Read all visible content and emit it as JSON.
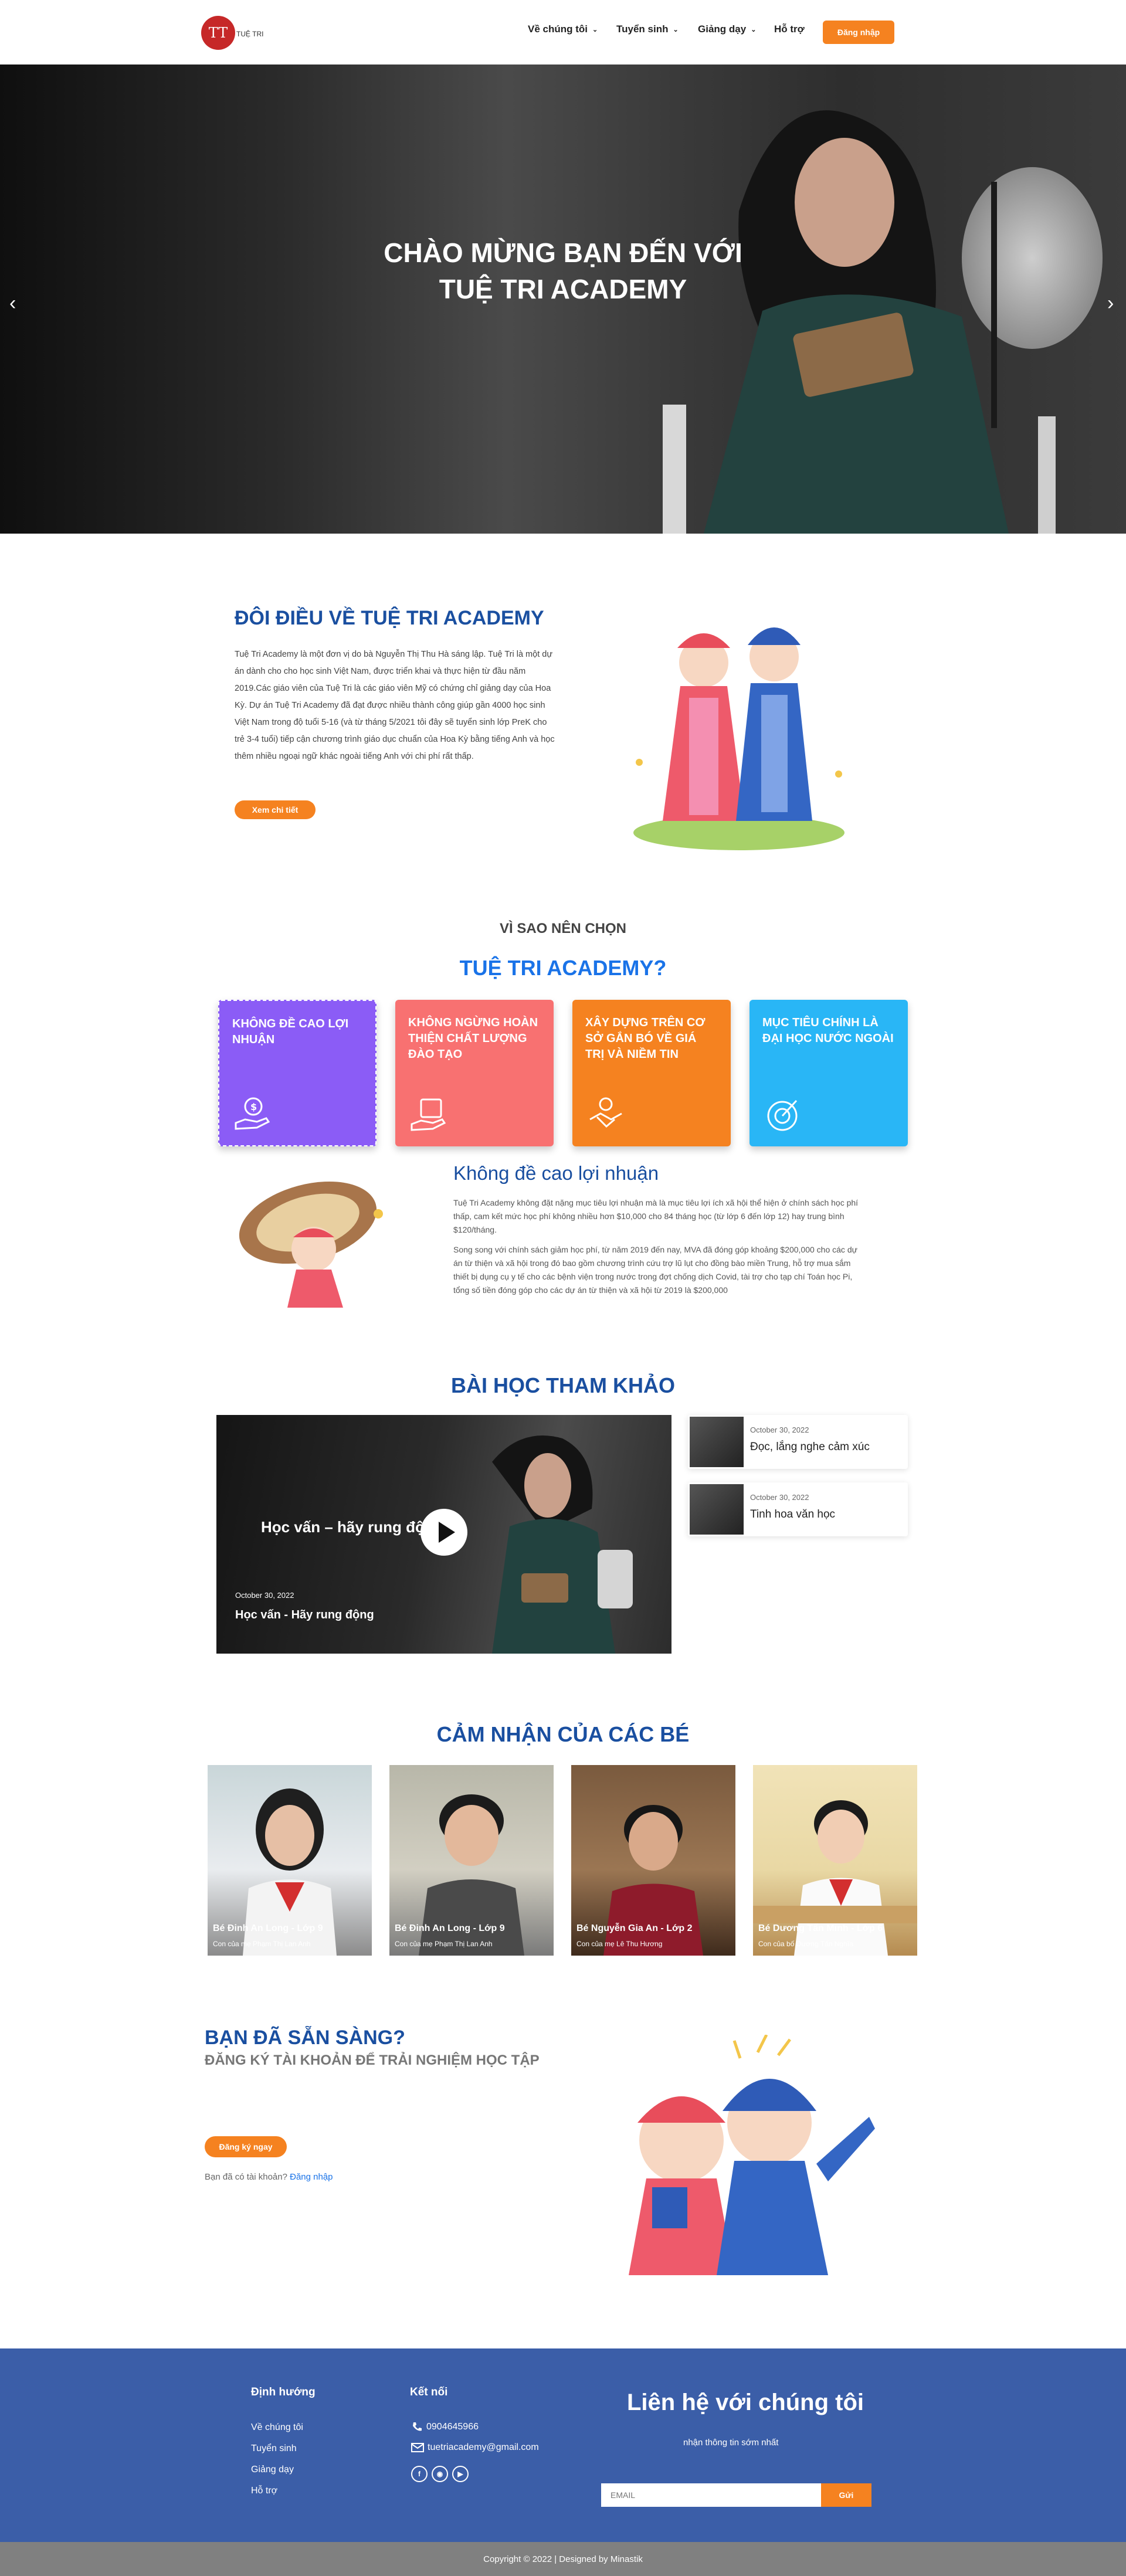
{
  "header": {
    "logo_initials": "TT",
    "logo_text": "TUỆ TRI",
    "nav": [
      {
        "label": "Về chúng tôi",
        "has_dropdown": true
      },
      {
        "label": "Tuyển sinh",
        "has_dropdown": true
      },
      {
        "label": "Giảng dạy",
        "has_dropdown": true
      },
      {
        "label": "Hỗ trợ",
        "has_dropdown": false
      }
    ],
    "login_label": "Đăng nhập",
    "accent_color": "#f58220",
    "brand_color": "#c62828"
  },
  "hero": {
    "title": "CHÀO MỪNG BẠN ĐẾN VỚI\nTUỆ TRI ACADEMY",
    "prev_icon": "chevron-left-icon",
    "next_icon": "chevron-right-icon"
  },
  "about": {
    "title": "ĐÔI ĐIỀU VỀ TUỆ TRI ACADEMY",
    "body": "Tuệ Tri Academy là một đơn vị do bà Nguyễn Thị Thu Hà sáng lập. Tuệ Tri là một dự án dành cho cho học sinh Việt Nam, được triển khai và thực hiện từ đầu năm 2019.Các giáo viên của Tuệ Tri là các giáo viên Mỹ có chứng chỉ giảng dạy của Hoa Kỳ. Dự án Tuệ Tri Academy đã đạt được nhiều thành công giúp gần 4000 học sinh Việt Nam trong độ tuổi 5-16 (và từ tháng 5/2021 tôi đây sẽ tuyển sinh lớp PreK cho trẻ 3-4 tuổi) tiếp cận chương trình giáo dục chuẩn của Hoa Kỳ bằng tiếng Anh và học thêm nhiều ngoại ngữ khác ngoài tiếng Anh với chi phí rất thấp.",
    "button": "Xem chi tiết"
  },
  "why": {
    "subtitle": "VÌ SAO NÊN CHỌN",
    "title": "TUỆ TRI ACADEMY?",
    "cards": [
      {
        "label": "KHÔNG ĐỀ CAO LỢI NHUẬN",
        "color": "#8b5cf6",
        "icon": "money-hand-icon"
      },
      {
        "label": "KHÔNG NGỪNG HOÀN THIỆN CHẤT LƯỢNG ĐÀO TẠO",
        "color": "#f87171",
        "icon": "quality-hand-icon"
      },
      {
        "label": "XÂY DỰNG TRÊN CƠ SỞ GẮN BÓ VỀ GIÁ TRỊ VÀ NIỀM TIN",
        "color": "#f58220",
        "icon": "handshake-icon"
      },
      {
        "label": "MỤC TIÊU CHÍNH LÀ ĐẠI HỌC NƯỚC NGOÀI",
        "color": "#29b6f6",
        "icon": "target-icon"
      }
    ],
    "detail_title": "Không đề cao lợi nhuận",
    "detail_p1": "Tuệ Tri Academy không đặt nặng mục tiêu lợi nhuận mà là mục tiêu lợi ích xã hội thể hiện ở chính sách học phí thấp, cam kết mức học phí không nhiều hơn $10,000 cho 84 tháng học (từ lớp 6 đến lớp 12) hay trung bình $120/tháng.",
    "detail_p2": "Song song với chính sách giảm học phí, từ năm 2019 đến nay, MVA đã đóng góp khoảng $200,000 cho các dự án từ thiện và xã hội trong đó bao gồm chương trình cứu trợ lũ lụt cho đồng bào miền Trung, hỗ trợ mua sắm thiết bị dụng cụ y tế cho các bệnh viện trong nước trong đợt chống dịch Covid, tài trợ cho tạp chí Toán học Pi, tổng số tiền đóng góp cho các dự án từ thiện và xã hội từ 2019 là $200,000"
  },
  "lessons": {
    "title": "BÀI HỌC THAM KHẢO",
    "featured": {
      "overlay": "Học vấn – hãy rung động",
      "date": "October 30, 2022",
      "title": "Học vấn - Hãy rung động"
    },
    "side": [
      {
        "date": "October 30, 2022",
        "title": "Đọc, lắng nghe cảm xúc"
      },
      {
        "date": "October 30, 2022",
        "title": "Tinh hoa văn học"
      }
    ]
  },
  "testimonials": {
    "title": "CẢM NHẬN CỦA CÁC BÉ",
    "items": [
      {
        "name": "Bé Đinh An Long - Lớp 9",
        "sub": "Con của mẹ Phạm Thị Lan Anh"
      },
      {
        "name": "Bé Đinh An Long - Lớp 9",
        "sub": "Con của mẹ Phạm Thị Lan Anh"
      },
      {
        "name": "Bé Nguyễn Gia An - Lớp 2",
        "sub": "Con của mẹ Lê Thu Hương"
      },
      {
        "name": "Bé Dương Tấn Minh - Lớp 6",
        "sub": "Con của bố Dương Tấn Nghĩa"
      }
    ]
  },
  "cta": {
    "title": "BẠN ĐÃ SẴN SÀNG?",
    "subtitle": "ĐĂNG KÝ TÀI KHOẢN ĐỂ TRẢI NGHIỆM HỌC TẬP",
    "button": "Đăng ký ngay",
    "have_account": "Bạn đã có tài khoản?",
    "login_link": "Đăng nhập"
  },
  "footer": {
    "nav_title": "Định hướng",
    "nav_links": [
      "Về chúng tôi",
      "Tuyển sinh",
      "Giảng dạy",
      "Hỗ trợ"
    ],
    "connect_title": "Kết nối",
    "phone": "0904645966",
    "email": "tuetriacademy@gmail.com",
    "social": [
      "facebook-icon",
      "instagram-icon",
      "youtube-icon"
    ],
    "contact_title": "Liên hệ với chúng tôi",
    "contact_note": "nhận thông tin sớm nhất",
    "email_placeholder": "EMAIL",
    "send_label": "Gửi",
    "bg_color": "#3b5ea8"
  },
  "copyright": "Copyright © 2022 | Designed by Minastik"
}
